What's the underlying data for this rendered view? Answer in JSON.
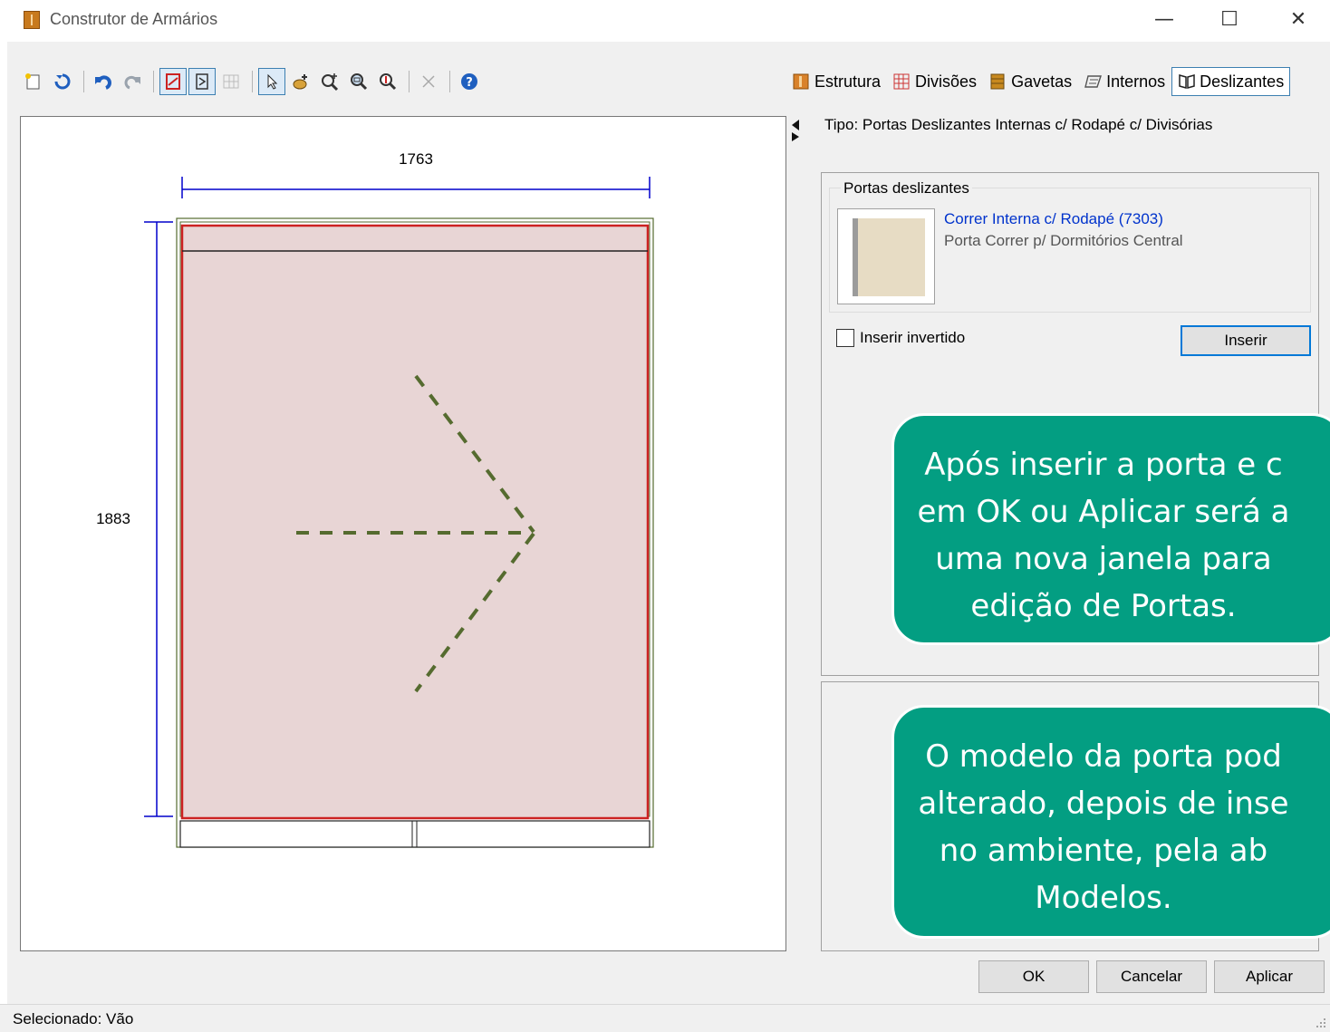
{
  "window": {
    "title": "Construtor de Armários",
    "controls": {
      "minimize": "—",
      "maximize": "☐",
      "close": "✕"
    }
  },
  "toolbar": {
    "icons": [
      "new-icon",
      "refresh-icon",
      "undo-icon",
      "redo-icon",
      "view-front-icon",
      "view-side-icon",
      "grid-icon",
      "select-pointer-icon",
      "pan-hand-icon",
      "zoom-in-icon",
      "zoom-window-icon",
      "zoom-fit-icon",
      "delete-icon",
      "help-icon"
    ]
  },
  "tabs": {
    "items": [
      {
        "label": "Estrutura",
        "icon": "estrutura-icon",
        "color": "#d9822b"
      },
      {
        "label": "Divisões",
        "icon": "divisoes-grid-icon",
        "color": "#2a7fd4"
      },
      {
        "label": "Gavetas",
        "icon": "gavetas-icon",
        "color": "#c8891f"
      },
      {
        "label": "Internos",
        "icon": "internos-icon",
        "color": "#555555"
      },
      {
        "label": "Deslizantes",
        "icon": "deslizantes-icon",
        "color": "#333333"
      }
    ],
    "active": "Deslizantes"
  },
  "drawing": {
    "width_label": "1763",
    "height_label": "1883",
    "colors": {
      "dimension": "#0000cc",
      "door_fill": "#e8d5d5",
      "door_border": "#cc2222",
      "arrow": "#556b2f",
      "frame": "#556b2f"
    }
  },
  "panel": {
    "tipo": "Tipo: Portas Deslizantes Internas c/ Rodapé c/ Divisórias",
    "group_label": "Portas deslizantes",
    "item_title": "Correr Interna c/ Rodapé (7303)",
    "item_desc": "Porta Correr p/ Dormitórios Central",
    "invert_label": "Inserir invertido",
    "invert_checked": false,
    "insert_button": "Inserir"
  },
  "callouts": {
    "first": [
      "Após inserir a porta e c",
      "em OK ou Aplicar será a",
      "uma nova janela para",
      "edição de Portas."
    ],
    "second": [
      "O modelo da porta pod",
      "alterado, depois de inse",
      "no ambiente, pela ab",
      "Modelos."
    ],
    "color": "#039e82"
  },
  "footer": {
    "ok": "OK",
    "cancel": "Cancelar",
    "apply": "Aplicar"
  },
  "status": {
    "text": "Selecionado: Vão"
  }
}
